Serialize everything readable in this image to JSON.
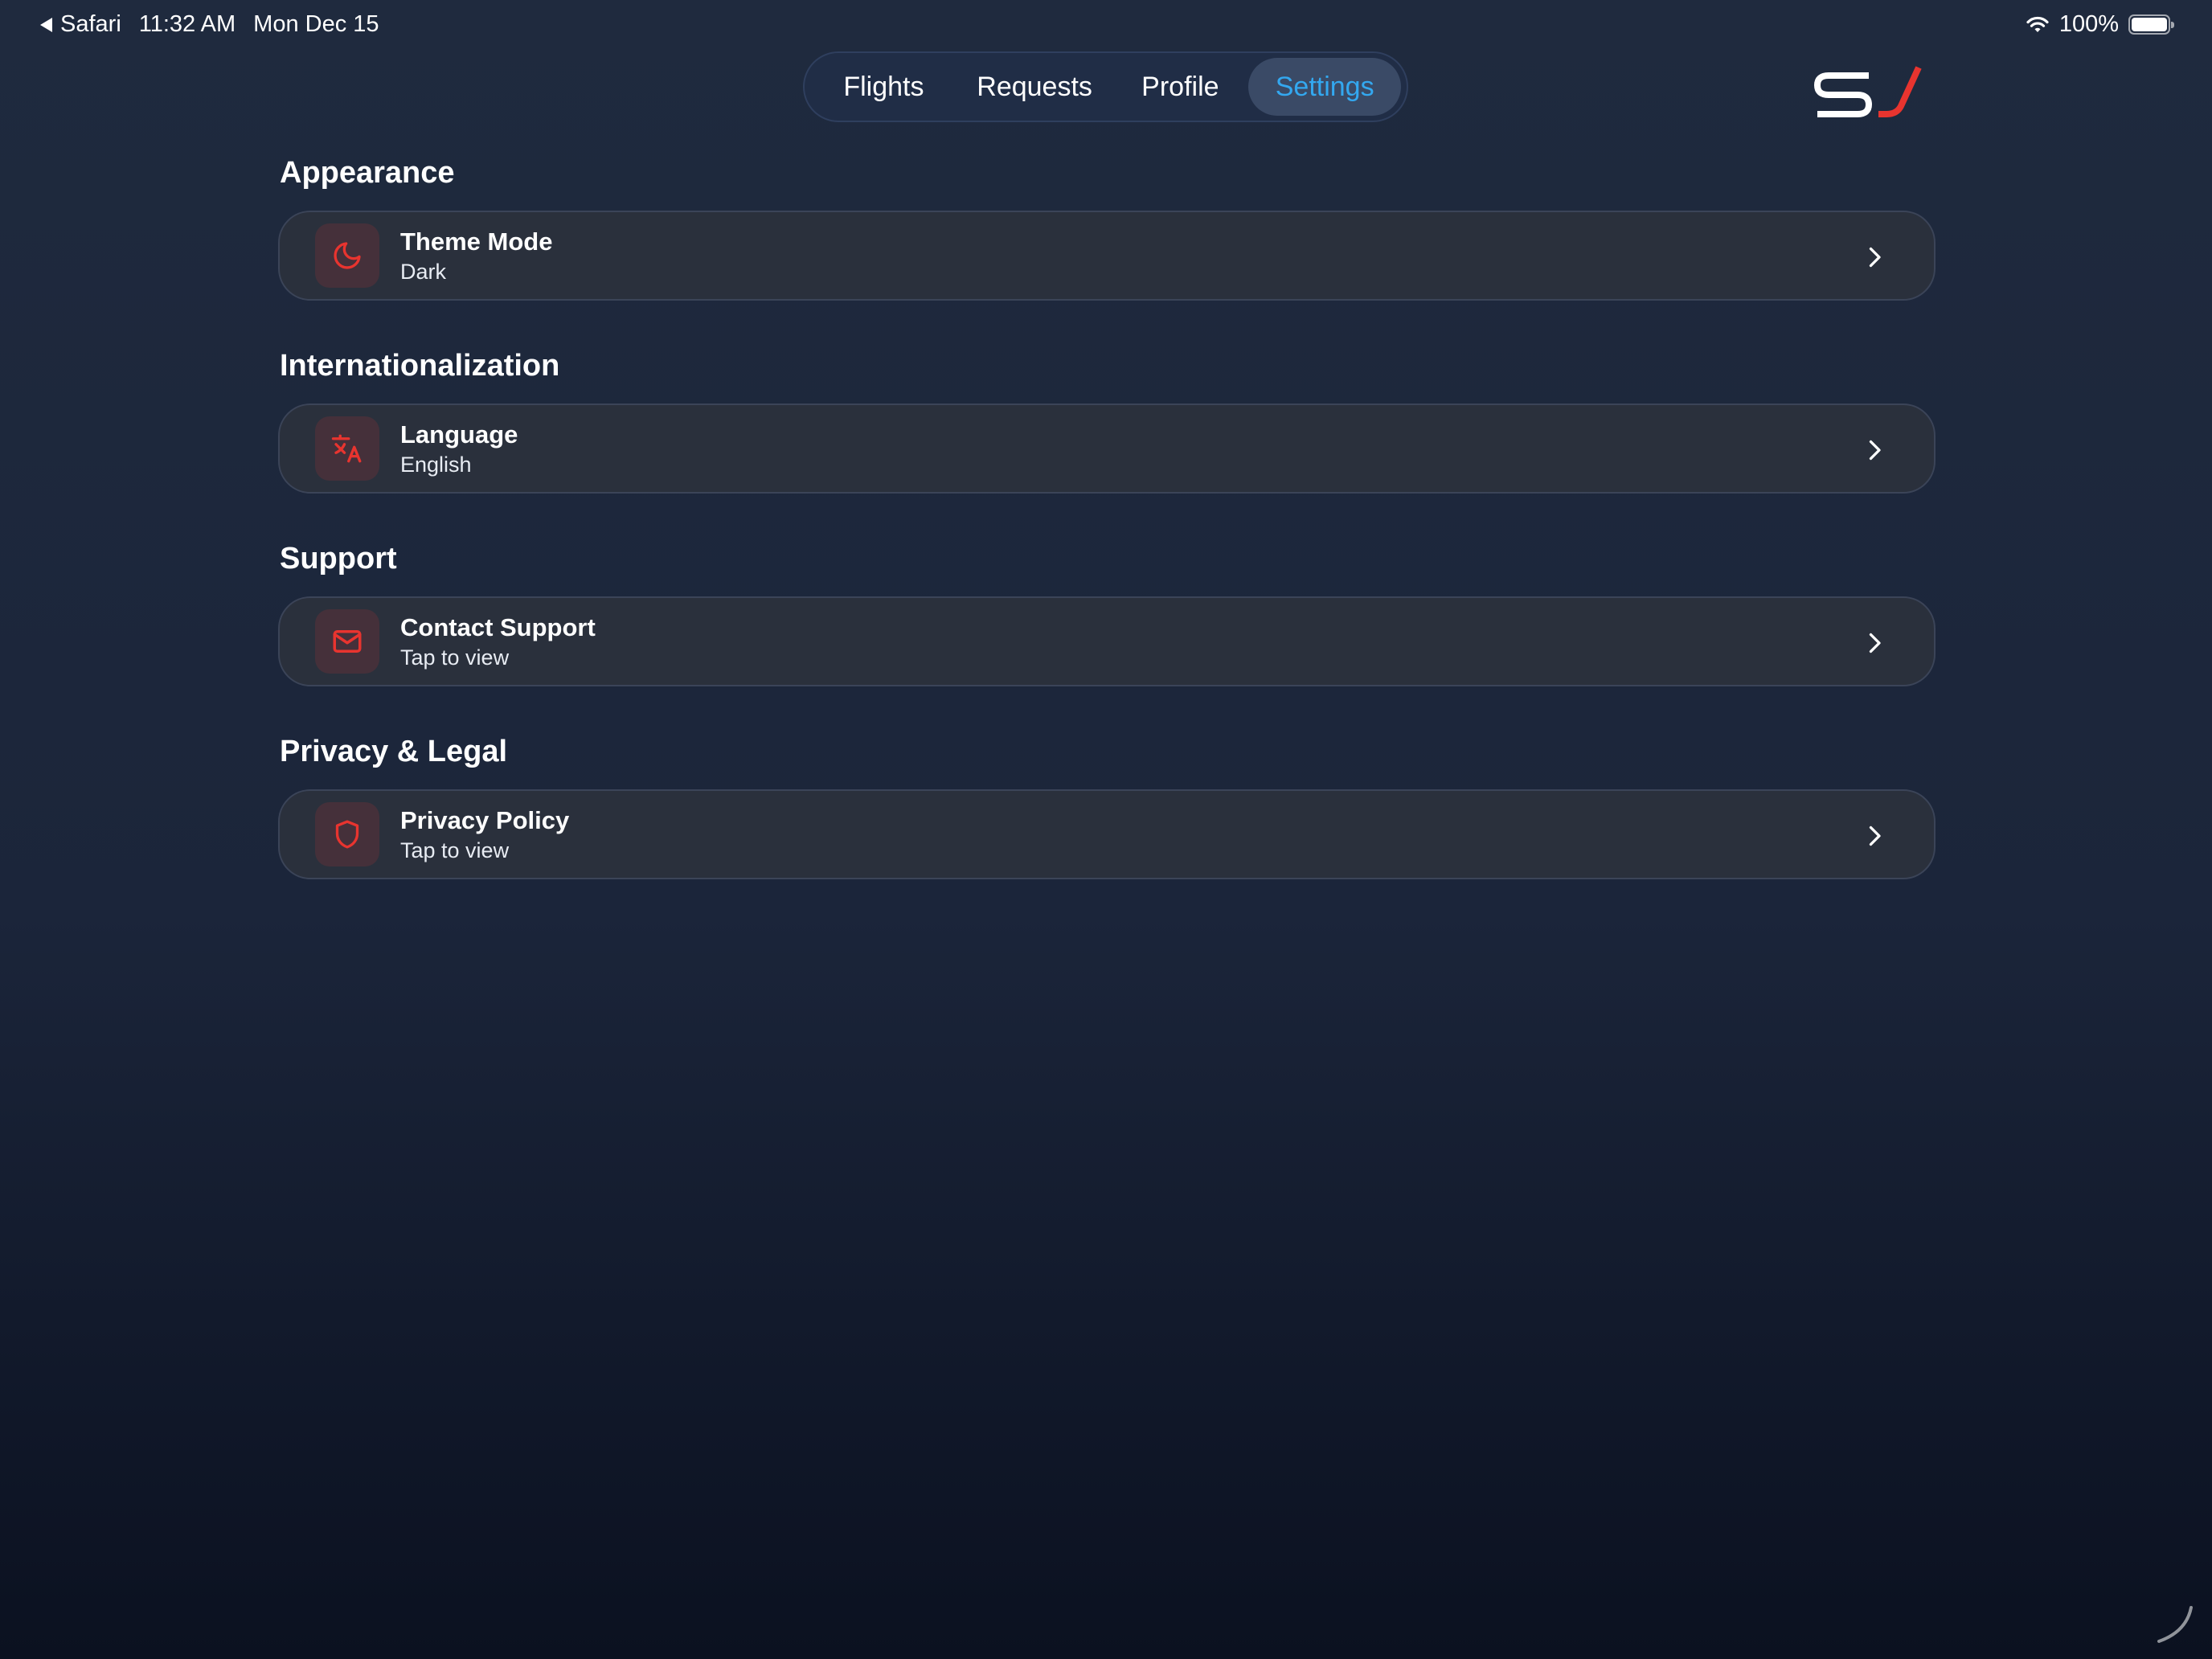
{
  "status_bar": {
    "back_app": "Safari",
    "time": "11:32 AM",
    "date": "Mon Dec 15",
    "battery": "100%"
  },
  "nav": {
    "tabs": [
      {
        "label": "Flights"
      },
      {
        "label": "Requests"
      },
      {
        "label": "Profile"
      },
      {
        "label": "Settings",
        "active": true
      }
    ]
  },
  "colors": {
    "accent": "#e8342f",
    "active_tab_text": "#33a8f0",
    "background": "#1f2a3e",
    "row_background": "#2a303c"
  },
  "sections": [
    {
      "title": "Appearance",
      "items": [
        {
          "label": "Theme Mode",
          "sub": "Dark",
          "icon": "moon-icon"
        }
      ]
    },
    {
      "title": "Internationalization",
      "items": [
        {
          "label": "Language",
          "sub": "English",
          "icon": "translate-icon"
        }
      ]
    },
    {
      "title": "Support",
      "items": [
        {
          "label": "Contact Support",
          "sub": "Tap to view",
          "icon": "mail-icon"
        }
      ]
    },
    {
      "title": "Privacy & Legal",
      "items": [
        {
          "label": "Privacy Policy",
          "sub": "Tap to view",
          "icon": "shield-icon"
        }
      ]
    }
  ]
}
